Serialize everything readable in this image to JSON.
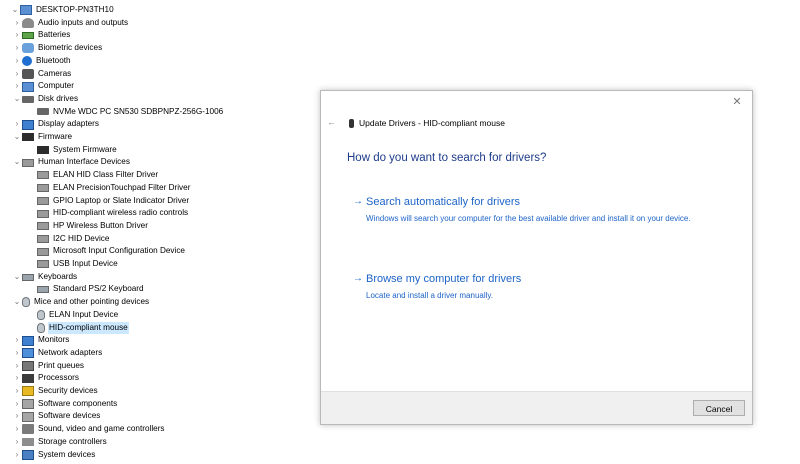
{
  "tree": {
    "root": "DESKTOP-PN3TH10",
    "rows": [
      {
        "label": "DESKTOP-PN3TH10",
        "level": 0,
        "chevron": "v",
        "icon": "computer-icon"
      },
      {
        "label": "Audio inputs and outputs",
        "level": 1,
        "chevron": ">",
        "icon": "speaker-icon"
      },
      {
        "label": "Batteries",
        "level": 1,
        "chevron": ">",
        "icon": "battery-icon"
      },
      {
        "label": "Biometric devices",
        "level": 1,
        "chevron": ">",
        "icon": "fingerprint-icon"
      },
      {
        "label": "Bluetooth",
        "level": 1,
        "chevron": ">",
        "icon": "bluetooth-icon"
      },
      {
        "label": "Cameras",
        "level": 1,
        "chevron": ">",
        "icon": "camera-icon"
      },
      {
        "label": "Computer",
        "level": 1,
        "chevron": ">",
        "icon": "computer-icon"
      },
      {
        "label": "Disk drives",
        "level": 1,
        "chevron": "v",
        "icon": "disk-icon"
      },
      {
        "label": "NVMe WDC PC SN530 SDBPNPZ-256G-1006",
        "level": 2,
        "chevron": "",
        "icon": "disk-icon"
      },
      {
        "label": "Display adapters",
        "level": 1,
        "chevron": ">",
        "icon": "display-adapter-icon"
      },
      {
        "label": "Firmware",
        "level": 1,
        "chevron": "v",
        "icon": "chip-icon"
      },
      {
        "label": "System Firmware",
        "level": 2,
        "chevron": "",
        "icon": "chip-icon"
      },
      {
        "label": "Human Interface Devices",
        "level": 1,
        "chevron": "v",
        "icon": "hid-icon"
      },
      {
        "label": "ELAN HID Class Filter Driver",
        "level": 2,
        "chevron": "",
        "icon": "hid-icon"
      },
      {
        "label": "ELAN PrecisionTouchpad Filter Driver",
        "level": 2,
        "chevron": "",
        "icon": "hid-icon"
      },
      {
        "label": "GPIO Laptop or Slate Indicator Driver",
        "level": 2,
        "chevron": "",
        "icon": "hid-icon"
      },
      {
        "label": "HID-compliant wireless radio controls",
        "level": 2,
        "chevron": "",
        "icon": "hid-icon"
      },
      {
        "label": "HP Wireless Button Driver",
        "level": 2,
        "chevron": "",
        "icon": "hid-icon"
      },
      {
        "label": "I2C HID Device",
        "level": 2,
        "chevron": "",
        "icon": "hid-icon"
      },
      {
        "label": "Microsoft Input Configuration Device",
        "level": 2,
        "chevron": "",
        "icon": "hid-icon"
      },
      {
        "label": "USB Input Device",
        "level": 2,
        "chevron": "",
        "icon": "hid-icon"
      },
      {
        "label": "Keyboards",
        "level": 1,
        "chevron": "v",
        "icon": "keyboard-icon"
      },
      {
        "label": "Standard PS/2 Keyboard",
        "level": 2,
        "chevron": "",
        "icon": "keyboard-icon"
      },
      {
        "label": "Mice and other pointing devices",
        "level": 1,
        "chevron": "v",
        "icon": "mouse-icon"
      },
      {
        "label": "ELAN Input Device",
        "level": 2,
        "chevron": "",
        "icon": "mouse-icon"
      },
      {
        "label": "HID-compliant mouse",
        "level": 2,
        "chevron": "",
        "icon": "mouse-icon",
        "selected": true
      },
      {
        "label": "Monitors",
        "level": 1,
        "chevron": ">",
        "icon": "monitor-icon"
      },
      {
        "label": "Network adapters",
        "level": 1,
        "chevron": ">",
        "icon": "network-icon"
      },
      {
        "label": "Print queues",
        "level": 1,
        "chevron": ">",
        "icon": "printer-icon"
      },
      {
        "label": "Processors",
        "level": 1,
        "chevron": ">",
        "icon": "processor-icon"
      },
      {
        "label": "Security devices",
        "level": 1,
        "chevron": ">",
        "icon": "security-icon"
      },
      {
        "label": "Software components",
        "level": 1,
        "chevron": ">",
        "icon": "software-icon"
      },
      {
        "label": "Software devices",
        "level": 1,
        "chevron": ">",
        "icon": "software-icon"
      },
      {
        "label": "Sound, video and game controllers",
        "level": 1,
        "chevron": ">",
        "icon": "sound-icon"
      },
      {
        "label": "Storage controllers",
        "level": 1,
        "chevron": ">",
        "icon": "storage-icon"
      },
      {
        "label": "System devices",
        "level": 1,
        "chevron": ">",
        "icon": "system-icon"
      }
    ]
  },
  "dialog": {
    "title": "Update Drivers - HID-compliant mouse",
    "question": "How do you want to search for drivers?",
    "option1": {
      "title": "Search automatically for drivers",
      "desc": "Windows will search your computer for the best available driver and install it on your device."
    },
    "option2": {
      "title": "Browse my computer for drivers",
      "desc": "Locate and install a driver manually."
    },
    "cancel_label": "Cancel",
    "arrow_glyph": "→",
    "back_glyph": "←",
    "close_glyph": "✕"
  },
  "colors": {
    "accent": "#1e64c8",
    "heading": "#1e3c8c",
    "selection": "#cce8ff"
  }
}
